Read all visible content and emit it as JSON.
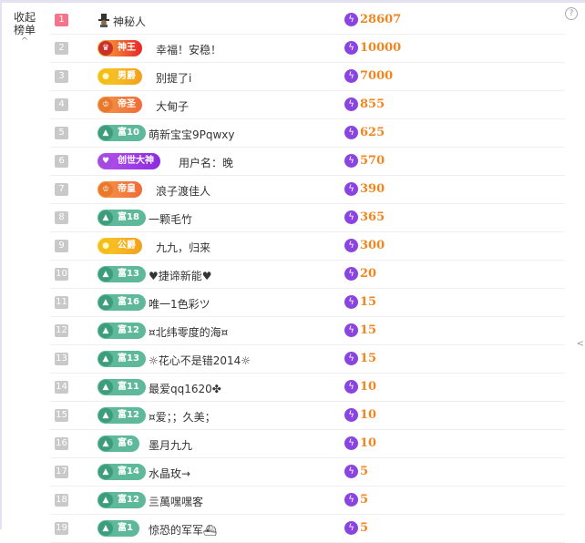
{
  "panel": {
    "collapse_label": "收起榜单",
    "help_label": "?",
    "right_arrow": "<"
  },
  "rows": [
    {
      "rank": "1",
      "badge_type": "none",
      "badge_label": "",
      "badge_icon": "hat-icon",
      "name": "神秘人",
      "score": "28607"
    },
    {
      "rank": "2",
      "badge_type": "red",
      "badge_label": "神王",
      "badge_icon": "crest-icon",
      "name": "幸福！安稳！",
      "score": "10000"
    },
    {
      "rank": "3",
      "badge_type": "gold",
      "badge_label": "男爵",
      "badge_icon": "coin-icon",
      "name": "别提了i",
      "score": "7000"
    },
    {
      "rank": "4",
      "badge_type": "orange",
      "badge_label": "帝圣",
      "badge_icon": "crown-icon",
      "name": "大甸子",
      "score": "855"
    },
    {
      "rank": "5",
      "badge_type": "rich",
      "badge_label": "富10",
      "badge_icon": "mountain-icon",
      "name": "萌新宝宝9Pqwxy",
      "score": "625"
    },
    {
      "rank": "6",
      "badge_type": "purple",
      "badge_label": "创世大神",
      "badge_icon": "heart-icon",
      "name": "用户名：晚",
      "score": "570"
    },
    {
      "rank": "7",
      "badge_type": "orange",
      "badge_label": "帝皇",
      "badge_icon": "crown-icon",
      "name": "浪子渡佳人",
      "score": "390"
    },
    {
      "rank": "8",
      "badge_type": "rich",
      "badge_label": "富18",
      "badge_icon": "mountain-icon",
      "name": "一颗毛竹",
      "score": "365"
    },
    {
      "rank": "9",
      "badge_type": "gold",
      "badge_label": "公爵",
      "badge_icon": "coin-icon",
      "name": "九九，归来",
      "score": "300"
    },
    {
      "rank": "10",
      "badge_type": "rich",
      "badge_label": "富13",
      "badge_icon": "mountain-icon",
      "name": "♥捷谛新能♥",
      "score": "20"
    },
    {
      "rank": "11",
      "badge_type": "rich",
      "badge_label": "富16",
      "badge_icon": "mountain-icon",
      "name": "唯一1色彩ツ",
      "score": "15"
    },
    {
      "rank": "12",
      "badge_type": "rich",
      "badge_label": "富12",
      "badge_icon": "mountain-icon",
      "name": "¤北纬零度的海¤",
      "score": "15"
    },
    {
      "rank": "13",
      "badge_type": "rich",
      "badge_label": "富13",
      "badge_icon": "mountain-icon",
      "name": "☼花心不是错2014☼",
      "score": "15"
    },
    {
      "rank": "14",
      "badge_type": "rich",
      "badge_label": "富11",
      "badge_icon": "mountain-icon",
      "name": "最爱qq1620✤",
      "score": "10"
    },
    {
      "rank": "15",
      "badge_type": "rich",
      "badge_label": "富12",
      "badge_icon": "mountain-icon",
      "name": "¤爱；；久美；",
      "score": "10"
    },
    {
      "rank": "16",
      "badge_type": "rich",
      "badge_label": "富6",
      "badge_icon": "mountain-icon",
      "name": "墨月九九",
      "score": "10"
    },
    {
      "rank": "17",
      "badge_type": "rich",
      "badge_label": "富14",
      "badge_icon": "mountain-icon",
      "name": "水晶玫→",
      "score": "5"
    },
    {
      "rank": "18",
      "badge_type": "rich",
      "badge_label": "富12",
      "badge_icon": "mountain-icon",
      "name": "亖萬嘿嘿客",
      "score": "5"
    },
    {
      "rank": "19",
      "badge_type": "rich",
      "badge_label": "富1",
      "badge_icon": "mountain-icon",
      "name": "惊恐的军军⛴",
      "score": "5"
    }
  ],
  "colors": {
    "rank_first": "#f4748c",
    "rank_default": "#c9c9c9",
    "score_text": "#f2861e",
    "bolt_bg": "#8a44e0",
    "rich_badge": "#5eb89a"
  }
}
